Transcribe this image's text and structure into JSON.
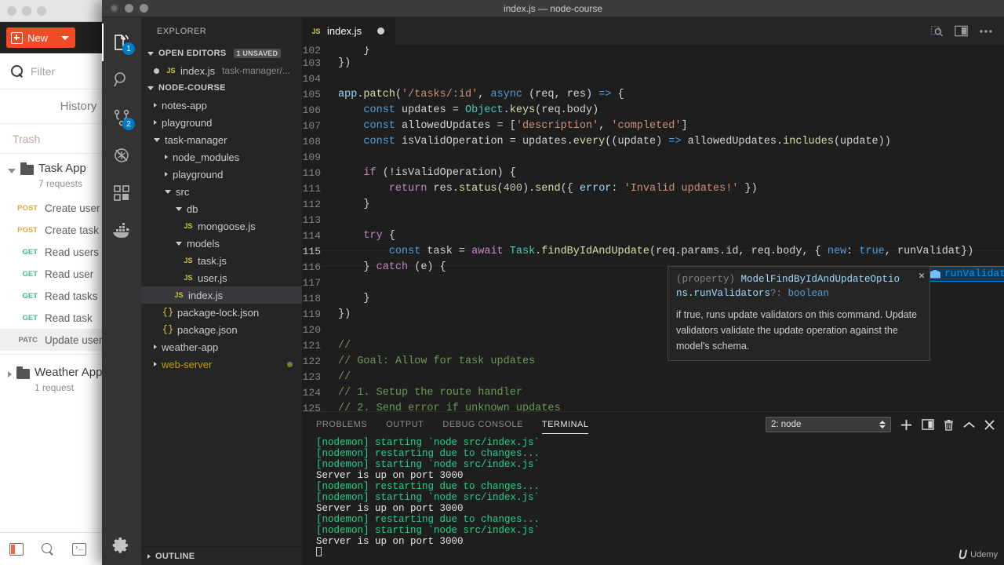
{
  "postman": {
    "new_button": "New",
    "new_caret_icon": "chevron-down-icon",
    "search_placeholder": "Filter",
    "search_icon": "search-icon",
    "history_label": "History",
    "trash_label": "Trash",
    "collections": [
      {
        "name": "Task App",
        "subtitle": "7 requests",
        "expanded": true
      },
      {
        "name": "Weather App",
        "subtitle": "1 request",
        "expanded": false
      }
    ],
    "requests": [
      {
        "verb": "POST",
        "name": "Create user",
        "verb_class": "v-post",
        "active": false
      },
      {
        "verb": "POST",
        "name": "Create task",
        "verb_class": "v-post",
        "active": false
      },
      {
        "verb": "GET",
        "name": "Read users",
        "verb_class": "v-get",
        "active": false
      },
      {
        "verb": "GET",
        "name": "Read user",
        "verb_class": "v-get",
        "active": false
      },
      {
        "verb": "GET",
        "name": "Read tasks",
        "verb_class": "v-get",
        "active": false
      },
      {
        "verb": "GET",
        "name": "Read task",
        "verb_class": "v-get",
        "active": false
      },
      {
        "verb": "PATC",
        "name": "Update user",
        "verb_class": "v-patch",
        "active": true
      }
    ],
    "bottom_icons": [
      "sidebar-toggle-icon",
      "search-icon",
      "console-icon"
    ]
  },
  "window": {
    "title": "index.js — node-course"
  },
  "activitybar": {
    "items": [
      {
        "icon": "files-explorer-icon",
        "badge": "1",
        "active": true
      },
      {
        "icon": "search-icon",
        "badge": "",
        "active": false
      },
      {
        "icon": "source-control-icon",
        "badge": "2",
        "active": false
      },
      {
        "icon": "run-debug-icon",
        "badge": "",
        "active": false
      },
      {
        "icon": "extensions-icon",
        "badge": "",
        "active": false
      },
      {
        "icon": "docker-icon",
        "badge": "",
        "active": false
      }
    ],
    "settings_icon": "gear-icon"
  },
  "sidebar": {
    "title": "EXPLORER",
    "open_editors": {
      "label": "OPEN EDITORS",
      "badge": "1 UNSAVED",
      "items": [
        {
          "name": "index.js",
          "path": "task-manager/...",
          "icon": "js-file-icon",
          "dirty": true
        }
      ]
    },
    "project": {
      "label": "NODE-COURSE",
      "tree": [
        {
          "label": "notes-app",
          "depth": 1,
          "kind": "folder",
          "state": "collapsed"
        },
        {
          "label": "playground",
          "depth": 1,
          "kind": "folder",
          "state": "collapsed"
        },
        {
          "label": "task-manager",
          "depth": 1,
          "kind": "folder",
          "state": "expanded"
        },
        {
          "label": "node_modules",
          "depth": 2,
          "kind": "folder",
          "state": "collapsed"
        },
        {
          "label": "playground",
          "depth": 2,
          "kind": "folder",
          "state": "collapsed"
        },
        {
          "label": "src",
          "depth": 2,
          "kind": "folder",
          "state": "expanded"
        },
        {
          "label": "db",
          "depth": 3,
          "kind": "folder",
          "state": "expanded"
        },
        {
          "label": "mongoose.js",
          "depth": 4,
          "kind": "js",
          "state": ""
        },
        {
          "label": "models",
          "depth": 3,
          "kind": "folder",
          "state": "expanded"
        },
        {
          "label": "task.js",
          "depth": 4,
          "kind": "js",
          "state": ""
        },
        {
          "label": "user.js",
          "depth": 4,
          "kind": "js",
          "state": ""
        },
        {
          "label": "index.js",
          "depth": 3,
          "kind": "js",
          "state": "",
          "selected": true
        },
        {
          "label": "package-lock.json",
          "depth": 2,
          "kind": "json",
          "state": ""
        },
        {
          "label": "package.json",
          "depth": 2,
          "kind": "json",
          "state": ""
        },
        {
          "label": "weather-app",
          "depth": 1,
          "kind": "folder",
          "state": "collapsed"
        },
        {
          "label": "web-server",
          "depth": 1,
          "kind": "folder",
          "state": "collapsed",
          "modified": true
        }
      ]
    },
    "outline_label": "OUTLINE"
  },
  "editor": {
    "tab": {
      "label": "index.js",
      "icon": "js-file-icon",
      "dirty": true
    },
    "actions": [
      "split-search-icon",
      "split-editor-icon",
      "more-actions-icon"
    ],
    "first_visible_line": 102,
    "cursor_line": 115,
    "code": [
      {
        "n": 102,
        "tokens": []
      },
      {
        "n": 103,
        "tokens": [
          {
            "t": "})",
            "c": "t-pl"
          }
        ],
        "indent": 1
      },
      {
        "n": 104,
        "tokens": []
      },
      {
        "n": 105,
        "tokens": [
          {
            "t": "app",
            "c": "t-var"
          },
          {
            "t": ".",
            "c": "t-pl"
          },
          {
            "t": "patch",
            "c": "t-fn"
          },
          {
            "t": "(",
            "c": "t-pl"
          },
          {
            "t": "'/tasks/:id'",
            "c": "t-str"
          },
          {
            "t": ", ",
            "c": "t-pl"
          },
          {
            "t": "async",
            "c": "t-decl"
          },
          {
            "t": " (req, res) ",
            "c": "t-pl"
          },
          {
            "t": "=>",
            "c": "t-arrow"
          },
          {
            "t": " {",
            "c": "t-pl"
          }
        ]
      },
      {
        "n": 106,
        "indent": 1,
        "tokens": [
          {
            "t": "const",
            "c": "t-decl"
          },
          {
            "t": " updates = ",
            "c": "t-pl"
          },
          {
            "t": "Object",
            "c": "t-cls"
          },
          {
            "t": ".",
            "c": "t-pl"
          },
          {
            "t": "keys",
            "c": "t-fn"
          },
          {
            "t": "(req.body)",
            "c": "t-pl"
          }
        ]
      },
      {
        "n": 107,
        "indent": 1,
        "tokens": [
          {
            "t": "const",
            "c": "t-decl"
          },
          {
            "t": " allowedUpdates = [",
            "c": "t-pl"
          },
          {
            "t": "'description'",
            "c": "t-str"
          },
          {
            "t": ", ",
            "c": "t-pl"
          },
          {
            "t": "'completed'",
            "c": "t-str"
          },
          {
            "t": "]",
            "c": "t-pl"
          }
        ]
      },
      {
        "n": 108,
        "indent": 1,
        "tokens": [
          {
            "t": "const",
            "c": "t-decl"
          },
          {
            "t": " isValidOperation = updates.",
            "c": "t-pl"
          },
          {
            "t": "every",
            "c": "t-fn"
          },
          {
            "t": "((update) ",
            "c": "t-pl"
          },
          {
            "t": "=>",
            "c": "t-arrow"
          },
          {
            "t": " allowedUpdates.",
            "c": "t-pl"
          },
          {
            "t": "includes",
            "c": "t-fn"
          },
          {
            "t": "(update))",
            "c": "t-pl"
          }
        ]
      },
      {
        "n": 109,
        "tokens": []
      },
      {
        "n": 110,
        "indent": 1,
        "tokens": [
          {
            "t": "if",
            "c": "t-kw"
          },
          {
            "t": " (!isValidOperation) {",
            "c": "t-pl"
          }
        ]
      },
      {
        "n": 111,
        "indent": 2,
        "tokens": [
          {
            "t": "return",
            "c": "t-kw"
          },
          {
            "t": " res.",
            "c": "t-pl"
          },
          {
            "t": "status",
            "c": "t-fn"
          },
          {
            "t": "(",
            "c": "t-pl"
          },
          {
            "t": "400",
            "c": "t-num"
          },
          {
            "t": ").",
            "c": "t-pl"
          },
          {
            "t": "send",
            "c": "t-fn"
          },
          {
            "t": "({ ",
            "c": "t-pl"
          },
          {
            "t": "error",
            "c": "t-var"
          },
          {
            "t": ": ",
            "c": "t-pl"
          },
          {
            "t": "'Invalid updates!'",
            "c": "t-str"
          },
          {
            "t": " })",
            "c": "t-pl"
          }
        ]
      },
      {
        "n": 112,
        "indent": 1,
        "tokens": [
          {
            "t": "}",
            "c": "t-pl"
          }
        ]
      },
      {
        "n": 113,
        "tokens": []
      },
      {
        "n": 114,
        "indent": 1,
        "tokens": [
          {
            "t": "try",
            "c": "t-kw"
          },
          {
            "t": " {",
            "c": "t-pl"
          }
        ]
      },
      {
        "n": 115,
        "indent": 2,
        "tokens": [
          {
            "t": "const",
            "c": "t-decl"
          },
          {
            "t": " task = ",
            "c": "t-pl"
          },
          {
            "t": "await",
            "c": "t-kw"
          },
          {
            "t": " ",
            "c": "t-pl"
          },
          {
            "t": "Task",
            "c": "t-cls"
          },
          {
            "t": ".",
            "c": "t-pl"
          },
          {
            "t": "findByIdAndUpdate",
            "c": "t-fn"
          },
          {
            "t": "(req.params.id, req.body, { ",
            "c": "t-pl"
          },
          {
            "t": "new",
            "c": "t-decl"
          },
          {
            "t": ": ",
            "c": "t-pl"
          },
          {
            "t": "true",
            "c": "t-decl"
          },
          {
            "t": ", runValidat})",
            "c": "t-pl"
          }
        ]
      },
      {
        "n": 116,
        "indent": 1,
        "tokens": [
          {
            "t": "} ",
            "c": "t-pl"
          },
          {
            "t": "catch",
            "c": "t-kw"
          },
          {
            "t": " (e) {",
            "c": "t-pl"
          }
        ]
      },
      {
        "n": 117,
        "tokens": []
      },
      {
        "n": 118,
        "indent": 1,
        "tokens": [
          {
            "t": "}",
            "c": "t-pl"
          }
        ]
      },
      {
        "n": 119,
        "tokens": [
          {
            "t": "})",
            "c": "t-pl"
          }
        ]
      },
      {
        "n": 120,
        "tokens": []
      },
      {
        "n": 121,
        "indent": 1,
        "tokens": [
          {
            "t": "//",
            "c": "t-cmt"
          }
        ]
      },
      {
        "n": 122,
        "indent": 1,
        "tokens": [
          {
            "t": "// Goal: Allow for task updates",
            "c": "t-cmt"
          }
        ]
      },
      {
        "n": 123,
        "indent": 1,
        "tokens": [
          {
            "t": "//",
            "c": "t-cmt"
          }
        ]
      },
      {
        "n": 124,
        "indent": 1,
        "tokens": [
          {
            "t": "// 1. Setup the route handler",
            "c": "t-cmt"
          }
        ]
      },
      {
        "n": 125,
        "indent": 1,
        "tokens": [
          {
            "t": "// 2. Send error if unknown updates",
            "c": "t-cmt"
          }
        ]
      }
    ],
    "suggest": {
      "icon": "property-suggestion-icon",
      "match": "runValidat",
      "rest": "ors"
    },
    "hover": {
      "signature_prefix": "(property) ",
      "signature": "ModelFindByIdAndUpdateOptio",
      "signature_line2_name": "ns.runValidators",
      "signature_line2_opt": "?: ",
      "signature_line2_type": "boolean",
      "close_icon": "close-icon",
      "doc": "if true, runs update validators on this command. Update validators validate the update operation against the model's schema."
    }
  },
  "panel": {
    "tabs": [
      {
        "label": "PROBLEMS",
        "active": false
      },
      {
        "label": "OUTPUT",
        "active": false
      },
      {
        "label": "DEBUG CONSOLE",
        "active": false
      },
      {
        "label": "TERMINAL",
        "active": true
      }
    ],
    "terminal_select_value": "2: node",
    "actions": [
      {
        "icon": "add-terminal-icon"
      },
      {
        "icon": "split-terminal-icon"
      },
      {
        "icon": "kill-terminal-icon"
      },
      {
        "icon": "maximize-panel-icon"
      },
      {
        "icon": "close-panel-icon"
      }
    ],
    "terminal_lines": [
      {
        "text": "[nodemon] starting `node src/index.js`",
        "c": "tl-green"
      },
      {
        "text": "[nodemon] restarting due to changes...",
        "c": "tl-green"
      },
      {
        "text": "[nodemon] starting `node src/index.js`",
        "c": "tl-green"
      },
      {
        "text": "Server is up on port 3000",
        "c": "tl-white"
      },
      {
        "text": "[nodemon] restarting due to changes...",
        "c": "tl-green"
      },
      {
        "text": "[nodemon] starting `node src/index.js`",
        "c": "tl-green"
      },
      {
        "text": "Server is up on port 3000",
        "c": "tl-white"
      },
      {
        "text": "[nodemon] restarting due to changes...",
        "c": "tl-green"
      },
      {
        "text": "[nodemon] starting `node src/index.js`",
        "c": "tl-green"
      },
      {
        "text": "Server is up on port 3000",
        "c": "tl-white"
      }
    ]
  },
  "watermark": {
    "brand": "Udemy"
  },
  "colors": {
    "accent": "#007acc",
    "postman_orange": "#ef4b25",
    "terminal_green": "#23d18b",
    "editor_bg": "#1e1e1e",
    "sidebar_bg": "#252526",
    "activitybar_bg": "#333333"
  }
}
